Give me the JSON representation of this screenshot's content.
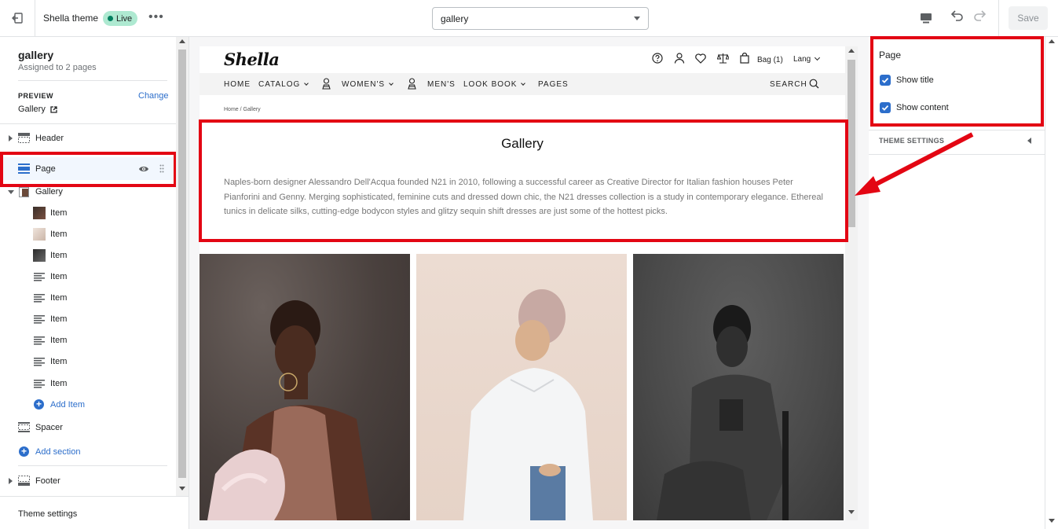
{
  "topbar": {
    "theme_name": "Shella theme",
    "live_badge": "Live",
    "more_label": "•••",
    "page_select_value": "gallery",
    "save_label": "Save"
  },
  "sidebar": {
    "title": "gallery",
    "subtitle": "Assigned to 2 pages",
    "preview_label": "PREVIEW",
    "change_label": "Change",
    "preview_value": "Gallery",
    "sections": {
      "header": "Header",
      "page": "Page",
      "gallery": "Gallery",
      "items": [
        "Item",
        "Item",
        "Item",
        "Item",
        "Item",
        "Item",
        "Item",
        "Item",
        "Item"
      ],
      "add_item": "Add Item",
      "spacer": "Spacer",
      "add_section": "Add section",
      "footer": "Footer"
    },
    "theme_settings": "Theme settings"
  },
  "store": {
    "logo": "Shella",
    "bag": "Bag (1)",
    "lang": "Lang",
    "nav": {
      "home": "HOME",
      "catalog": "CATALOG",
      "womens": "WOMEN'S",
      "mens": "MEN'S",
      "lookbook": "LOOK BOOK",
      "pages": "PAGES",
      "search": "SEARCH"
    },
    "breadcrumb": "Home  /  Gallery",
    "page_title": "Gallery",
    "page_content": "Naples-born designer Alessandro Dell'Acqua founded N21 in 2010, following a successful career as Creative Director for Italian fashion houses Peter Pianforini and Genny. Merging sophisticated, feminine cuts and dressed down chic, the N21 dresses collection is a study in contemporary elegance. Ethereal tunics in delicate silks, cutting-edge bodycon styles and glitzy sequin shift dresses are just some of the hottest picks."
  },
  "right_panel": {
    "title": "Page",
    "show_title": "Show title",
    "show_title_checked": true,
    "show_content": "Show content",
    "show_content_checked": true,
    "theme_settings": "THEME SETTINGS"
  },
  "colors": {
    "accent": "#2c6ecb",
    "highlight": "#e30613",
    "live_badge": "#aee9d1"
  }
}
